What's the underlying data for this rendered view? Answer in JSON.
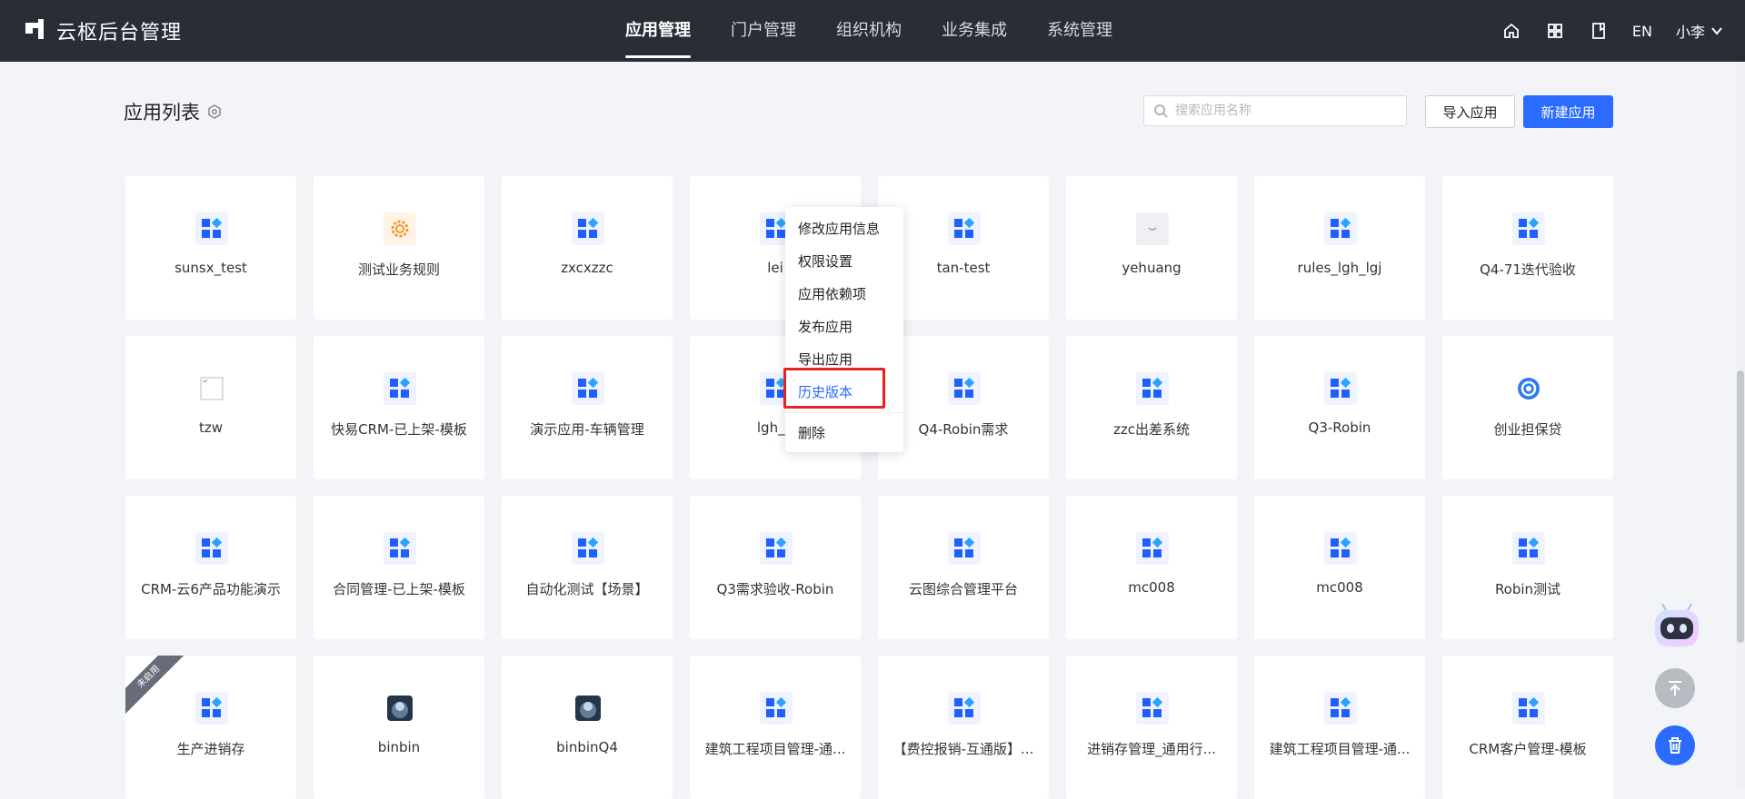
{
  "app": {
    "title": "云枢后台管理"
  },
  "nav": [
    {
      "label": "应用管理",
      "active": true
    },
    {
      "label": "门户管理",
      "active": false
    },
    {
      "label": "组织机构",
      "active": false
    },
    {
      "label": "业务集成",
      "active": false
    },
    {
      "label": "系统管理",
      "active": false
    }
  ],
  "topbar": {
    "lang": "EN",
    "user": "小李"
  },
  "page": {
    "title": "应用列表"
  },
  "search": {
    "placeholder": "搜索应用名称",
    "value": ""
  },
  "buttons": {
    "import": "导入应用",
    "new": "新建应用"
  },
  "apps": [
    {
      "name": "sunsx_test",
      "icon": "grid-icon"
    },
    {
      "name": "测试业务规则",
      "icon": "gear-orange-icon"
    },
    {
      "name": "zxcxzzc",
      "icon": "grid-icon"
    },
    {
      "name": "lei",
      "icon": "grid-icon"
    },
    {
      "name": "tan-test",
      "icon": "grid-icon"
    },
    {
      "name": "yehuang",
      "icon": "smile-icon"
    },
    {
      "name": "rules_lgh_lgj",
      "icon": "grid-icon"
    },
    {
      "name": "Q4-71迭代验收",
      "icon": "grid-icon"
    },
    {
      "name": "tzw",
      "icon": "broken-image-icon"
    },
    {
      "name": "快易CRM-已上架-模板",
      "icon": "grid-icon"
    },
    {
      "name": "演示应用-车辆管理",
      "icon": "grid-icon"
    },
    {
      "name": "lgh_g",
      "icon": "grid-icon"
    },
    {
      "name": "Q4-Robin需求",
      "icon": "grid-icon"
    },
    {
      "name": "zzc出差系统",
      "icon": "grid-icon"
    },
    {
      "name": "Q3-Robin",
      "icon": "grid-icon"
    },
    {
      "name": "创业担保贷",
      "icon": "circle-logo-icon"
    },
    {
      "name": "CRM-云6产品功能演示",
      "icon": "grid-icon"
    },
    {
      "name": "合同管理-已上架-模板",
      "icon": "grid-icon"
    },
    {
      "name": "自动化测试【场景】",
      "icon": "grid-icon"
    },
    {
      "name": "Q3需求验收-Robin",
      "icon": "grid-icon"
    },
    {
      "name": "云图综合管理平台",
      "icon": "grid-icon"
    },
    {
      "name": "mc008",
      "icon": "grid-icon"
    },
    {
      "name": "mc008",
      "icon": "grid-icon"
    },
    {
      "name": "Robin测试",
      "icon": "grid-icon"
    },
    {
      "name": "生产进销存",
      "icon": "grid-icon",
      "ribbon": "未启用"
    },
    {
      "name": "binbin",
      "icon": "photo-icon"
    },
    {
      "name": "binbinQ4",
      "icon": "photo-icon"
    },
    {
      "name": "建筑工程项目管理-通...",
      "icon": "grid-icon"
    },
    {
      "name": "【费控报销-互通版】...",
      "icon": "grid-icon"
    },
    {
      "name": "进销存管理_通用行...",
      "icon": "grid-icon"
    },
    {
      "name": "建筑工程项目管理-通...",
      "icon": "grid-icon"
    },
    {
      "name": "CRM客户管理-模板",
      "icon": "grid-icon"
    }
  ],
  "context_menu": {
    "items": [
      {
        "label": "修改应用信息"
      },
      {
        "label": "权限设置"
      },
      {
        "label": "应用依赖项"
      },
      {
        "label": "发布应用"
      },
      {
        "label": "导出应用"
      },
      {
        "label": "历史版本",
        "highlighted": true
      }
    ],
    "danger": {
      "label": "删除"
    }
  },
  "colors": {
    "topbar": "#292d36",
    "primary": "#2b6bff",
    "highlight_box": "#e52323"
  }
}
